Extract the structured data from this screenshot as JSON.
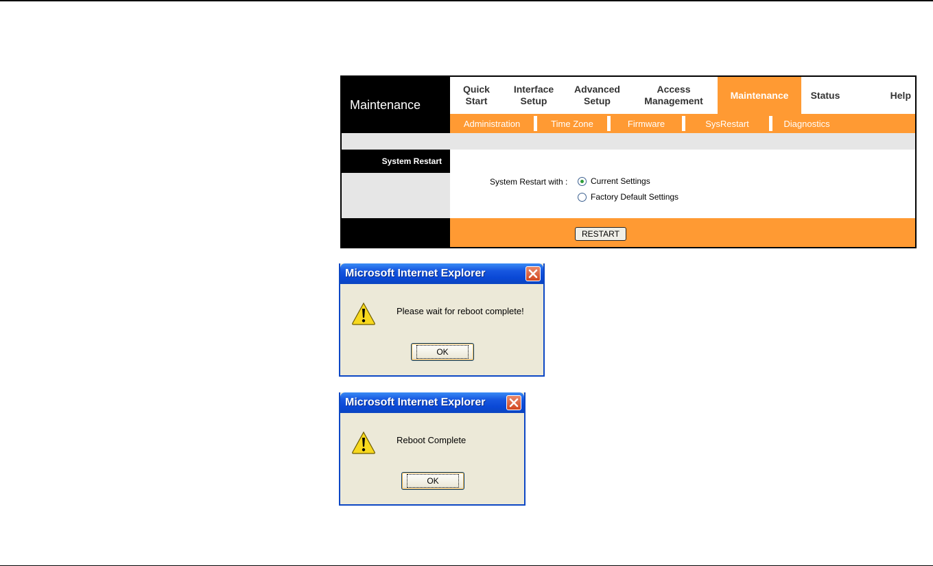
{
  "router": {
    "title": "Maintenance",
    "nav": [
      {
        "label": "Quick\nStart",
        "active": false
      },
      {
        "label": "Interface\nSetup",
        "active": false
      },
      {
        "label": "Advanced\nSetup",
        "active": false
      },
      {
        "label": "Access\nManagement",
        "active": false
      },
      {
        "label": "Maintenance",
        "active": true
      },
      {
        "label": "Status",
        "active": false
      },
      {
        "label": "Help",
        "active": false
      }
    ],
    "subnav": [
      "Administration",
      "Time Zone",
      "Firmware",
      "SysRestart",
      "Diagnostics"
    ],
    "section_label": "System Restart",
    "restart_with_label": "System Restart with :",
    "options": [
      {
        "label": "Current Settings",
        "checked": true
      },
      {
        "label": "Factory Default Settings",
        "checked": false
      }
    ],
    "restart_button": "RESTART",
    "accent_color": "#ff9a33"
  },
  "dialogs": [
    {
      "title": "Microsoft Internet Explorer",
      "message": "Please wait for reboot complete!",
      "ok_label": "OK",
      "icon": "warning-icon"
    },
    {
      "title": "Microsoft Internet Explorer",
      "message": "Reboot Complete",
      "ok_label": "OK",
      "icon": "warning-icon"
    }
  ]
}
